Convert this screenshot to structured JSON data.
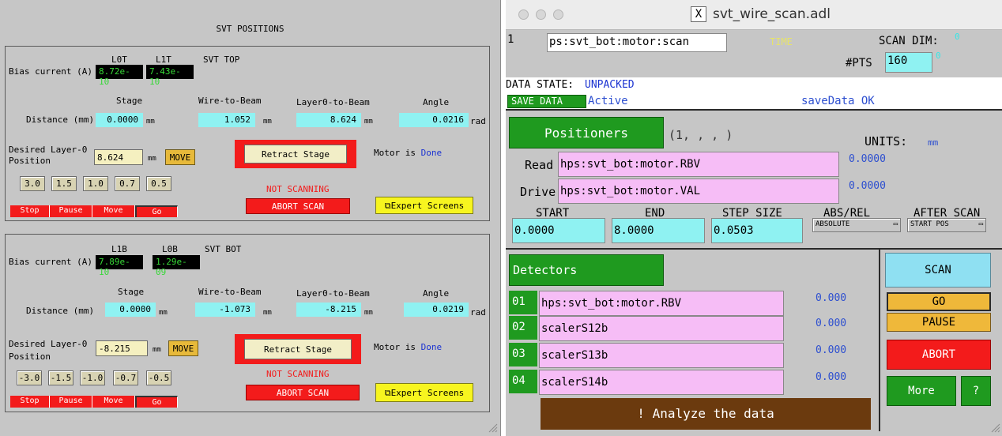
{
  "svt": {
    "title": "SVT POSITIONS",
    "bias_label": "Bias current (A)",
    "stage_header": "Stage",
    "wire_header": "Wire-to-Beam",
    "layer0_header": "Layer0-to-Beam",
    "angle_header": "Angle",
    "distance_label": "Distance (mm)",
    "unit_mm": "mm",
    "unit_rad": "rad",
    "desired_label_line1": "Desired Layer-0",
    "desired_label_line2": "Position",
    "move_label": "MOVE",
    "retract_label": "Retract Stage",
    "motor_prefix": "Motor is",
    "not_scanning": "NOT SCANNING",
    "abort_scan": "ABORT SCAN",
    "expert_screens": "Expert Screens",
    "ctrl": [
      "Stop",
      "Pause",
      "Move",
      "Go"
    ],
    "top": {
      "name": "SVT TOP",
      "ch1_label": "L0T",
      "ch1_value": "8.72e-10",
      "ch2_label": "L1T",
      "ch2_value": "7.43e-10",
      "stage": "0.0000",
      "wire": "1.052",
      "layer0": "8.624",
      "angle": "0.0216",
      "desired": "8.624",
      "motor_status": "Done",
      "steps": [
        "3.0",
        "1.5",
        "1.0",
        "0.7",
        "0.5"
      ]
    },
    "bot": {
      "name": "SVT BOT",
      "ch1_label": "L1B",
      "ch1_value": "7.89e-10",
      "ch2_label": "L0B",
      "ch2_value": "1.29e-09",
      "stage": "0.0000",
      "wire": "-1.073",
      "layer0": "-8.215",
      "angle": "0.0219",
      "desired": "-8.215",
      "motor_status": "Done",
      "steps": [
        "-3.0",
        "-1.5",
        "-1.0",
        "-0.7",
        "-0.5"
      ]
    }
  },
  "scan": {
    "window_title": "svt_wire_scan.adl",
    "dim_number": "1",
    "pv_field": "ps:svt_bot:motor:scan",
    "time_label": "TIME",
    "scan_dim_label": "SCAN DIM:",
    "scan_dim_value": "0",
    "pts_label": "#PTS",
    "pts_value": "160",
    "pts_extra": "0",
    "data_state_label": "DATA STATE:",
    "data_state_value": "UNPACKED",
    "save_data_btn": "SAVE DATA",
    "save_status": "Active",
    "save_msg": "saveData OK",
    "positioners_btn": "Positioners",
    "positioners_idx": "(1, , , )",
    "units_label": "UNITS:",
    "units_value": "mm",
    "read_label": "Read",
    "read_pv": "hps:svt_bot:motor.RBV",
    "read_value": "0.0000",
    "drive_label": "Drive",
    "drive_pv": "hps:svt_bot:motor.VAL",
    "drive_value": "0.0000",
    "start_label": "START",
    "end_label": "END",
    "step_label": "STEP SIZE",
    "absrel_label": "ABS/REL",
    "after_label": "AFTER SCAN",
    "start_value": "0.0000",
    "end_value": "8.0000",
    "step_value": "0.0503",
    "absrel_value": "ABSOLUTE",
    "after_value": "START POS",
    "detectors_btn": "Detectors",
    "detectors": [
      {
        "num": "01",
        "pv": "hps:svt_bot:motor.RBV",
        "value": "0.000"
      },
      {
        "num": "02",
        "pv": "scalerS12b",
        "value": "0.000"
      },
      {
        "num": "03",
        "pv": "scalerS13b",
        "value": "0.000"
      },
      {
        "num": "04",
        "pv": "scalerS14b",
        "value": "0.000"
      }
    ],
    "scan_btn": "SCAN",
    "go_btn": "GO",
    "pause_btn": "PAUSE",
    "abort_btn": "ABORT",
    "more_btn": "More",
    "help_btn": "?",
    "analyze_btn": "Analyze the data",
    "analyze_icon": "!"
  }
}
